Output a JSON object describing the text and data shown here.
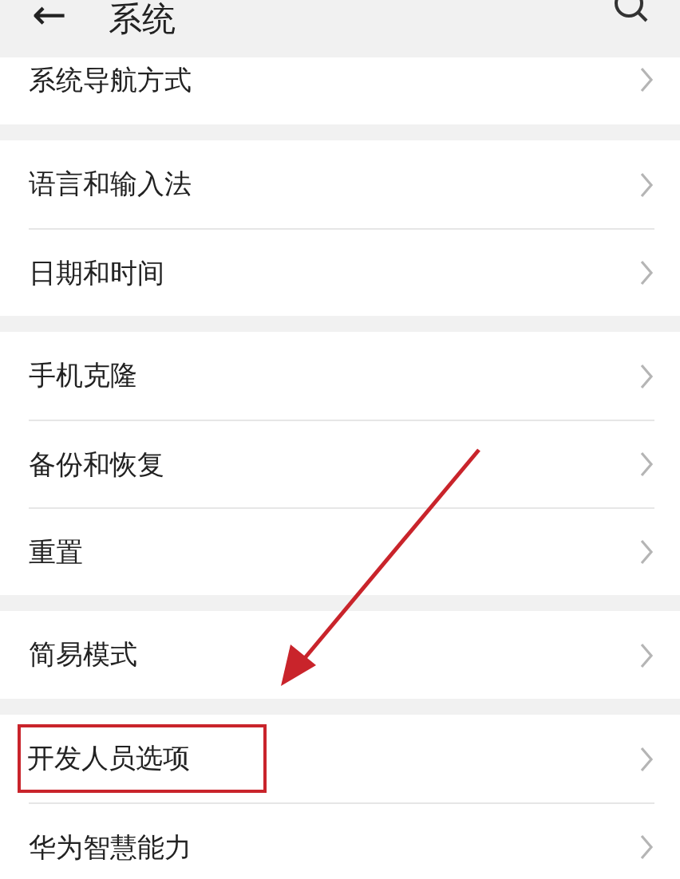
{
  "header": {
    "back": "←",
    "title": "系统"
  },
  "groups": [
    {
      "items": [
        {
          "label": "系统导航方式",
          "highlighted": false
        }
      ]
    },
    {
      "items": [
        {
          "label": "语言和输入法",
          "highlighted": false
        },
        {
          "label": "日期和时间",
          "highlighted": false
        }
      ]
    },
    {
      "items": [
        {
          "label": "手机克隆",
          "highlighted": false
        },
        {
          "label": "备份和恢复",
          "highlighted": false
        },
        {
          "label": "重置",
          "highlighted": false
        }
      ]
    },
    {
      "items": [
        {
          "label": "简易模式",
          "highlighted": false
        }
      ]
    },
    {
      "items": [
        {
          "label": "开发人员选项",
          "highlighted": true
        },
        {
          "label": "华为智慧能力",
          "highlighted": false
        }
      ]
    }
  ],
  "annotations": [
    {
      "kind": "arrow"
    }
  ]
}
